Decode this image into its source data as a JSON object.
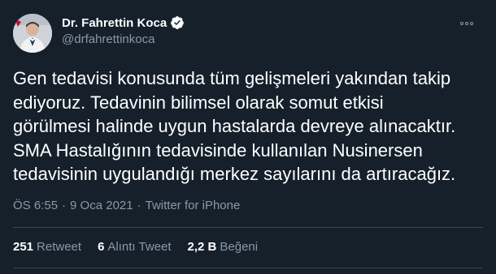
{
  "author": {
    "name": "Dr. Fahrettin Koca",
    "handle": "@drfahrettinkoca"
  },
  "tweet": {
    "lines": [
      "Gen tedavisi konusunda tüm gelişmeleri yakından takip",
      "ediyoruz. Tedavinin bilimsel olarak somut etkisi",
      "görülmesi halinde uygun hastalarda devreye alınacaktır.",
      "SMA Hastalığının tedavisinde kullanılan Nusinersen",
      "tedavisinin uygulandığı merkez sayılarını da artıracağız."
    ],
    "time": "ÖS 6:55",
    "separator": "·",
    "date": "9 Oca 2021",
    "source": "Twitter for iPhone"
  },
  "stats": {
    "retweets_count": "251",
    "retweets_label": "Retweet",
    "quotes_count": "6",
    "quotes_label": "Alıntı Tweet",
    "likes_count": "2,2 B",
    "likes_label": "Beğeni"
  },
  "colors": {
    "background": "#15202b",
    "secondary_text": "#8899a6",
    "verified_badge": "#ffffff",
    "divider": "#38444d"
  }
}
